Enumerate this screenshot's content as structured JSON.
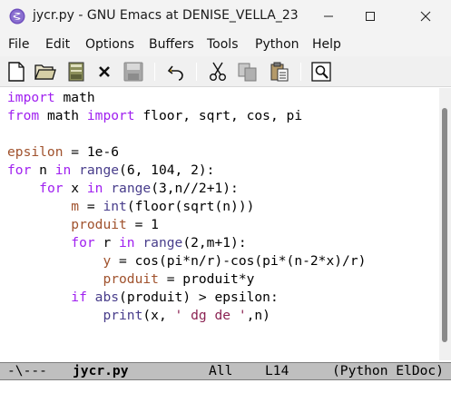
{
  "window": {
    "title": "jycr.py - GNU Emacs at DENISE_VELLA_23",
    "icon": "emacs-icon",
    "controls": [
      "minimize-icon",
      "maximize-icon",
      "close-icon"
    ]
  },
  "menubar": {
    "items": [
      "File",
      "Edit",
      "Options",
      "Buffers",
      "Tools",
      "Python",
      "Help"
    ]
  },
  "toolbar": {
    "buttons": [
      "new-file-icon",
      "open-folder-icon",
      "save-icon",
      "close-buffer-icon",
      "save-as-icon",
      "undo-icon",
      "cut-icon",
      "copy-icon",
      "paste-icon",
      "search-icon"
    ]
  },
  "editor": {
    "lines": [
      [
        {
          "t": "import",
          "c": "kw"
        },
        {
          "t": " math",
          "c": ""
        }
      ],
      [
        {
          "t": "from",
          "c": "kw"
        },
        {
          "t": " math ",
          "c": ""
        },
        {
          "t": "import",
          "c": "kw"
        },
        {
          "t": " floor, sqrt, cos, pi",
          "c": ""
        }
      ],
      [],
      [
        {
          "t": "epsilon",
          "c": "var"
        },
        {
          "t": " = 1e-6",
          "c": ""
        }
      ],
      [
        {
          "t": "for",
          "c": "kw"
        },
        {
          "t": " n ",
          "c": ""
        },
        {
          "t": "in",
          "c": "kw"
        },
        {
          "t": " ",
          "c": ""
        },
        {
          "t": "range",
          "c": "bi"
        },
        {
          "t": "(6, 104, 2):",
          "c": ""
        }
      ],
      [
        {
          "t": "    ",
          "c": ""
        },
        {
          "t": "for",
          "c": "kw"
        },
        {
          "t": " x ",
          "c": ""
        },
        {
          "t": "in",
          "c": "kw"
        },
        {
          "t": " ",
          "c": ""
        },
        {
          "t": "range",
          "c": "bi"
        },
        {
          "t": "(3,n//2+1):",
          "c": ""
        }
      ],
      [
        {
          "t": "        ",
          "c": ""
        },
        {
          "t": "m",
          "c": "var"
        },
        {
          "t": " = ",
          "c": ""
        },
        {
          "t": "int",
          "c": "bi"
        },
        {
          "t": "(floor(sqrt(n)))",
          "c": ""
        }
      ],
      [
        {
          "t": "        ",
          "c": ""
        },
        {
          "t": "produit",
          "c": "var"
        },
        {
          "t": " = 1",
          "c": ""
        }
      ],
      [
        {
          "t": "        ",
          "c": ""
        },
        {
          "t": "for",
          "c": "kw"
        },
        {
          "t": " r ",
          "c": ""
        },
        {
          "t": "in",
          "c": "kw"
        },
        {
          "t": " ",
          "c": ""
        },
        {
          "t": "range",
          "c": "bi"
        },
        {
          "t": "(2,m+1):",
          "c": ""
        }
      ],
      [
        {
          "t": "            ",
          "c": ""
        },
        {
          "t": "y",
          "c": "var"
        },
        {
          "t": " = cos(pi*n/r)-cos(pi*(n-2*x)/r)",
          "c": ""
        }
      ],
      [
        {
          "t": "            ",
          "c": ""
        },
        {
          "t": "produit",
          "c": "var"
        },
        {
          "t": " = produit*y",
          "c": ""
        }
      ],
      [
        {
          "t": "        ",
          "c": ""
        },
        {
          "t": "if",
          "c": "kw"
        },
        {
          "t": " ",
          "c": ""
        },
        {
          "t": "abs",
          "c": "bi"
        },
        {
          "t": "(produit) > epsilon:",
          "c": ""
        }
      ],
      [
        {
          "t": "            ",
          "c": ""
        },
        {
          "t": "print",
          "c": "bi"
        },
        {
          "t": "(x, ",
          "c": ""
        },
        {
          "t": "' dg de '",
          "c": "str"
        },
        {
          "t": ",n)",
          "c": ""
        }
      ]
    ]
  },
  "modeline": {
    "status": "-\\---",
    "buffer_name": "jycr.py",
    "position": "All",
    "line": "L14",
    "mode": "(Python ElDoc)"
  }
}
